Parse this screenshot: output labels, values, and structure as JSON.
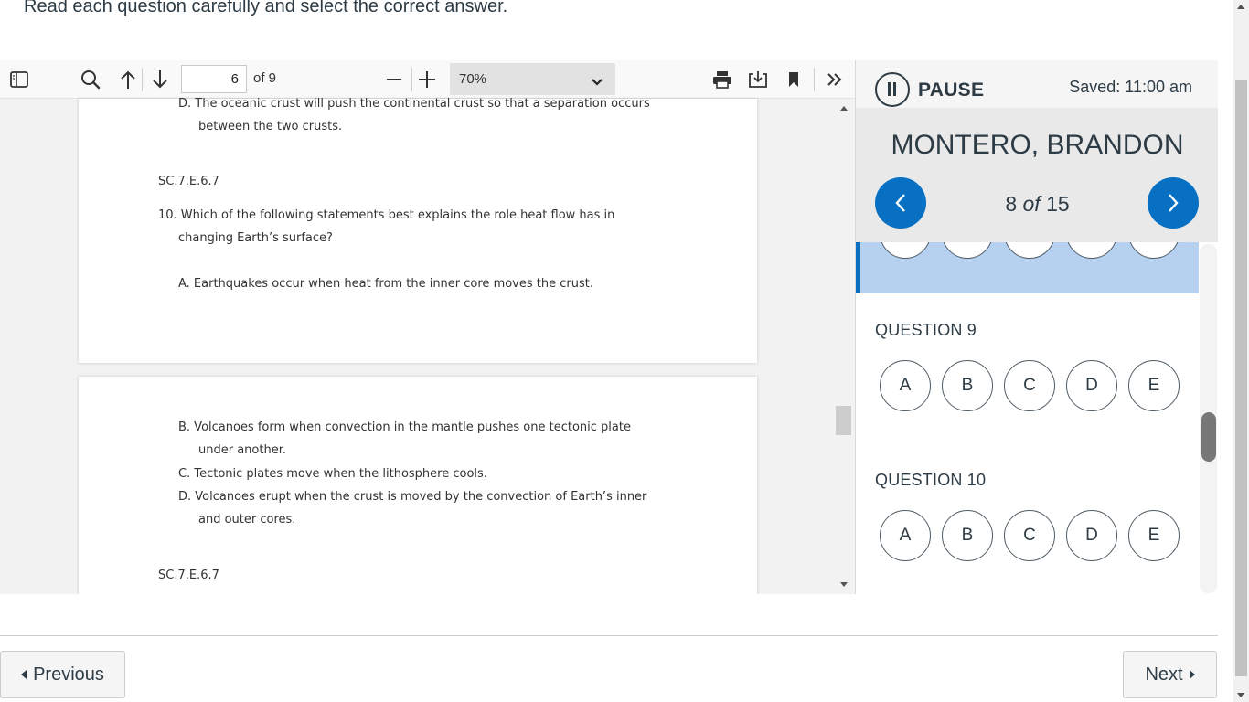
{
  "instructions": "Read each question carefully and select the correct answer.",
  "viewer": {
    "page_current": "6",
    "page_total": "of 9",
    "zoom": "70%",
    "page_a_lines": [
      "D.  The oceanic crust will push the continental crust so that a separation occurs",
      "between the two crusts.",
      "SC.7.E.6.7",
      "10. Which of the following statements best explains the role heat flow has in",
      "changing Earth’s surface?",
      "A.  Earthquakes occur when heat from the inner core moves the crust."
    ],
    "page_b_lines": [
      "B.  Volcanoes form when convection in the mantle pushes one tectonic plate",
      "under another.",
      "C.  Tectonic plates move when the lithosphere cools.",
      "D.  Volcanoes erupt when the crust is moved by the convection of Earth’s inner",
      "and outer cores.",
      "SC.7.E.6.7"
    ]
  },
  "panel": {
    "pause_label": "PAUSE",
    "saved": "Saved: 11:00 am",
    "student": "MONTERO, BRANDON",
    "counter_current": "8",
    "counter_of": "of",
    "counter_total": "15",
    "questions": [
      {
        "title": "QUESTION 9",
        "options": [
          "A",
          "B",
          "C",
          "D",
          "E"
        ]
      },
      {
        "title": "QUESTION 10",
        "options": [
          "A",
          "B",
          "C",
          "D",
          "E"
        ]
      }
    ]
  },
  "footer": {
    "previous": "Previous",
    "next": "Next"
  },
  "colors": {
    "accent": "#0770c2",
    "highlight": "#b5d1ef",
    "text": "#2d3b45"
  }
}
